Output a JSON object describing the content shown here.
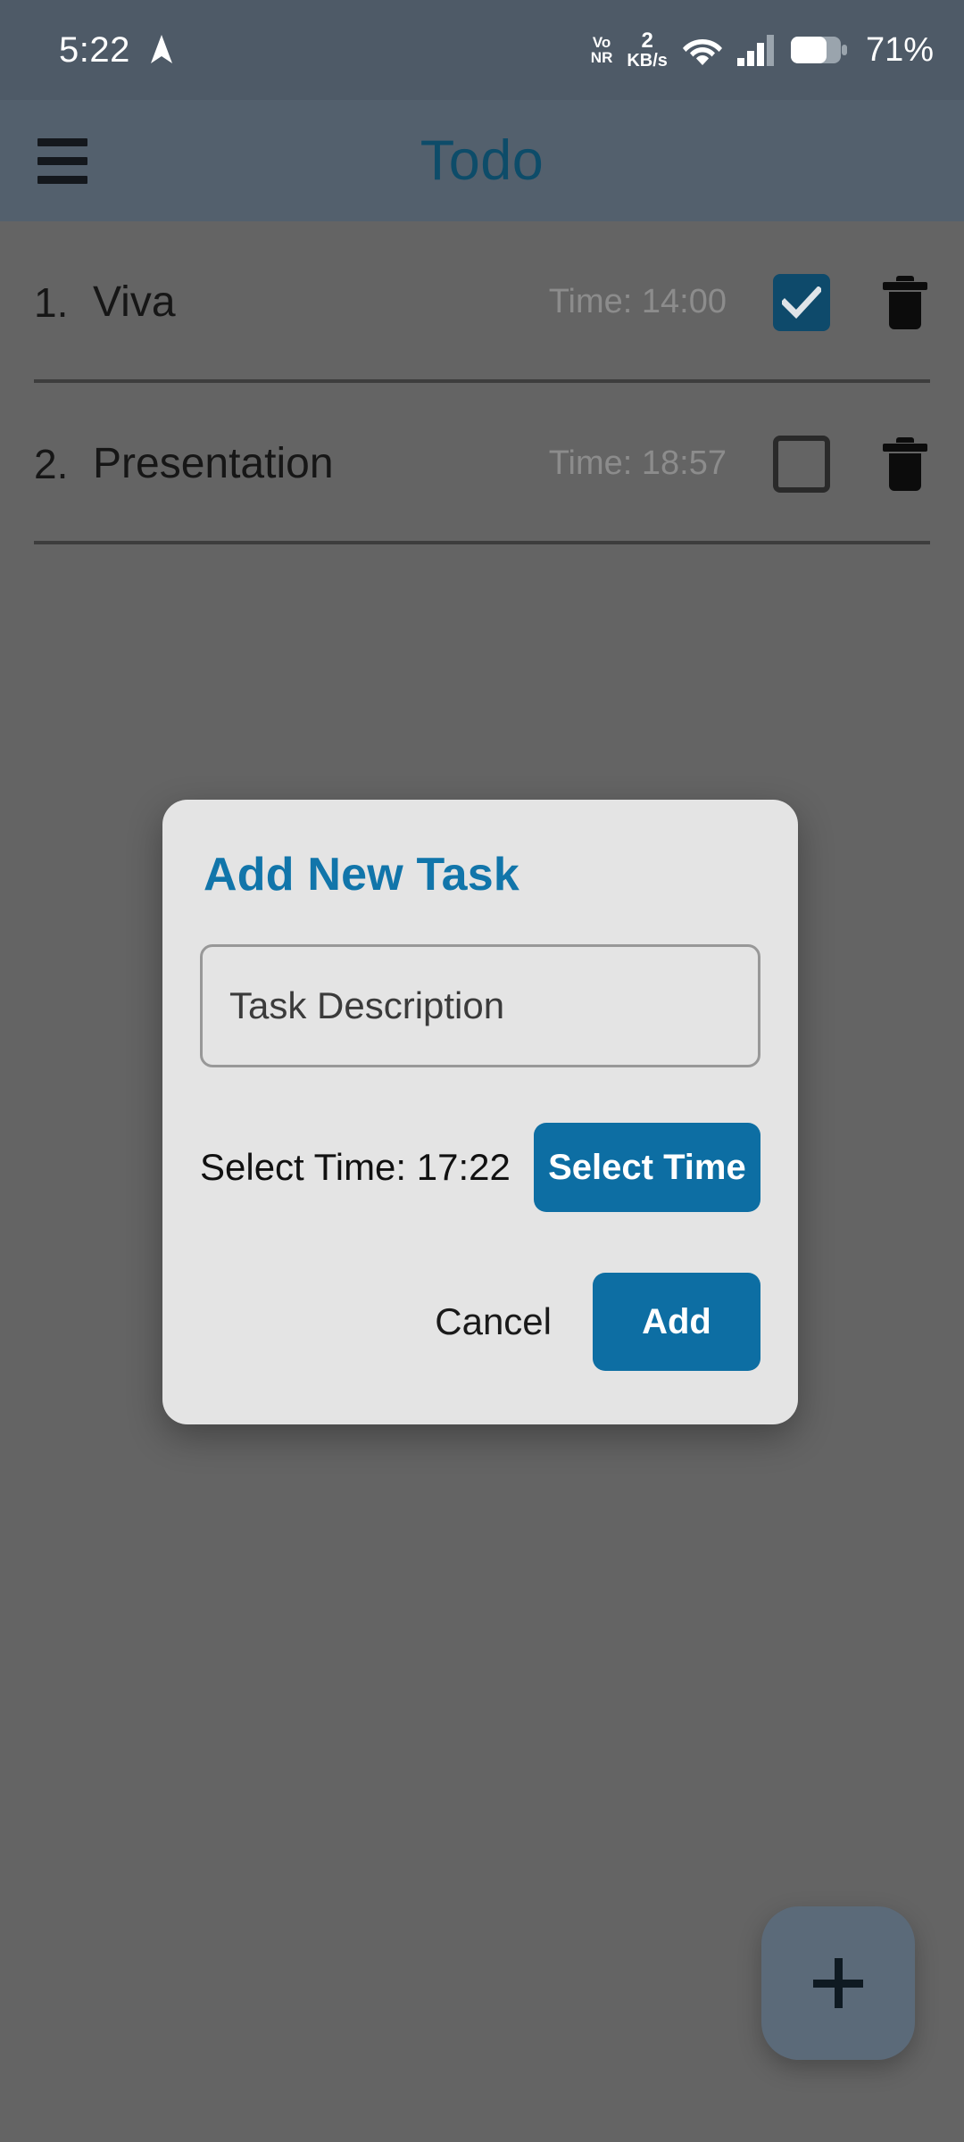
{
  "status_bar": {
    "clock": "5:22",
    "nav_icon": "navigation-arrow-icon",
    "volte_line1": "Vo",
    "volte_line2": "NR",
    "net_speed_value": "2",
    "net_speed_unit": "KB/s",
    "wifi_icon": "wifi-icon",
    "signal_icon": "cellular-signal-icon",
    "battery_icon": "battery-icon",
    "battery_percent": "71%"
  },
  "app_bar": {
    "menu_icon": "hamburger-menu-icon",
    "title": "Todo",
    "title_color": "#0d4c69",
    "background_color": "#53606d"
  },
  "tasks": [
    {
      "index": "1.",
      "title": "Viva",
      "time_label": "Time: 14:00",
      "checked": true
    },
    {
      "index": "2.",
      "title": "Presentation",
      "time_label": "Time: 18:57",
      "checked": false
    }
  ],
  "dialog": {
    "title": "Add New Task",
    "title_color": "#1175aa",
    "background_color": "#e4e4e4",
    "description_placeholder": "Task Description",
    "description_value": "",
    "time_label": "Select Time: 17:22",
    "select_time_button": "Select Time",
    "cancel_button": "Cancel",
    "add_button": "Add",
    "accent_color": "#0d6ea3"
  },
  "fab": {
    "icon": "plus-icon",
    "background_color": "#5b6a79"
  }
}
